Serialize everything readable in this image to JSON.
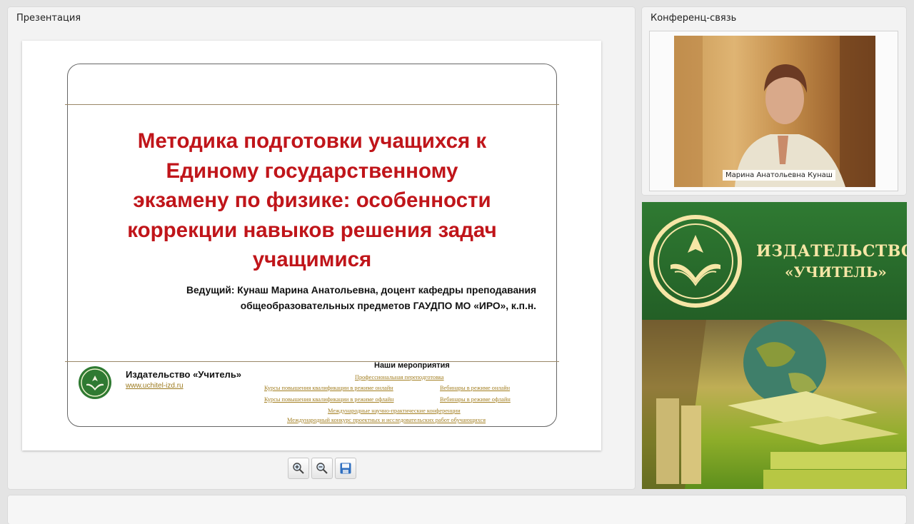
{
  "presentation": {
    "panel_title": "Презентация",
    "slide": {
      "title_lines": [
        "Методика подготовки учащихся к",
        "Единому государственному",
        "экзамену по физике: особенности",
        "коррекции навыков решения задач",
        "учащимися"
      ],
      "presenter_lines": [
        "Ведущий: Кунаш Марина Анатольевна, доцент кафедры преподавания",
        "общеобразовательных предметов ГАУДПО МО «ИРО», к.п.н."
      ],
      "publisher_name": "Издательство «Учитель»",
      "publisher_url": "www.uchitel-izd.ru",
      "events_heading": "Наши мероприятия",
      "events": [
        "Профессиональная переподготовка",
        "Курсы повышения квалификации в режиме онлайн",
        "Вебинары в режиме онлайн",
        "Курсы повышения квалификации в режиме офлайн",
        "Вебинары в режиме офлайн",
        "Международные научно-практические конференции",
        "Международный конкурс проектных и исследовательских работ обучающихся"
      ],
      "colors": {
        "title": "#c0151a",
        "link": "#a37f22",
        "rule": "#9a8766"
      }
    },
    "toolbar": {
      "icons": [
        "zoom-in-icon",
        "zoom-out-icon",
        "save-icon"
      ]
    }
  },
  "conference": {
    "panel_title": "Конференц-связь",
    "participant_name": "Марина Анатольевна Кунаш"
  },
  "banner": {
    "line1": "ИЗДАТЕЛЬСТВО",
    "line2": "«УЧИТЕЛЬ»",
    "colors": {
      "green": "#2f7a32",
      "gold": "#f6e6a6"
    }
  }
}
